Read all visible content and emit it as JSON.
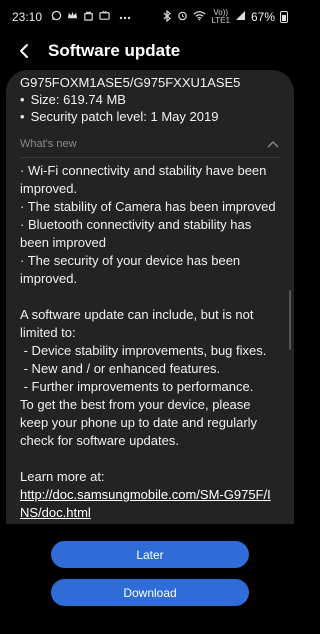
{
  "status_bar": {
    "time": "23:10",
    "left_icons": [
      "whatsapp-icon",
      "crown-icon",
      "shop-icon",
      "tv-icon",
      "more-dots-icon"
    ],
    "right_icons": [
      "bluetooth-icon",
      "alarm-icon",
      "wifi-icon",
      "signal-icon"
    ],
    "volte_line1": "Vo))",
    "volte_line2": "LTE1",
    "battery_percent": "67%"
  },
  "header": {
    "title": "Software update"
  },
  "update_info": {
    "build": "G975FOXM1ASE5/G975FXXU1ASE5",
    "size": "Size: 619.74 MB",
    "patch": "Security patch level: 1 May 2019"
  },
  "whats_new": {
    "label": "What's new",
    "items": [
      "· Wi-Fi connectivity and stability have been improved.",
      "· The stability of Camera has been improved",
      "· Bluetooth connectivity and stability has been improved",
      "· The security of your device has been improved."
    ],
    "general_intro": "A software update can include, but is not limited to:",
    "general_items": [
      " - Device stability improvements, bug fixes.",
      " - New and / or enhanced features.",
      " - Further improvements to performance."
    ],
    "advice": "To get the best from your device, please keep your phone up to date and regularly check for software updates.",
    "learn_more": "Learn more at:",
    "link": "http://doc.samsungmobile.com/SM-G975F/INS/doc.html"
  },
  "buttons": {
    "later": "Later",
    "download": "Download"
  },
  "colors": {
    "accent": "#2f6cd8",
    "card": "#232323",
    "background": "#000000"
  }
}
